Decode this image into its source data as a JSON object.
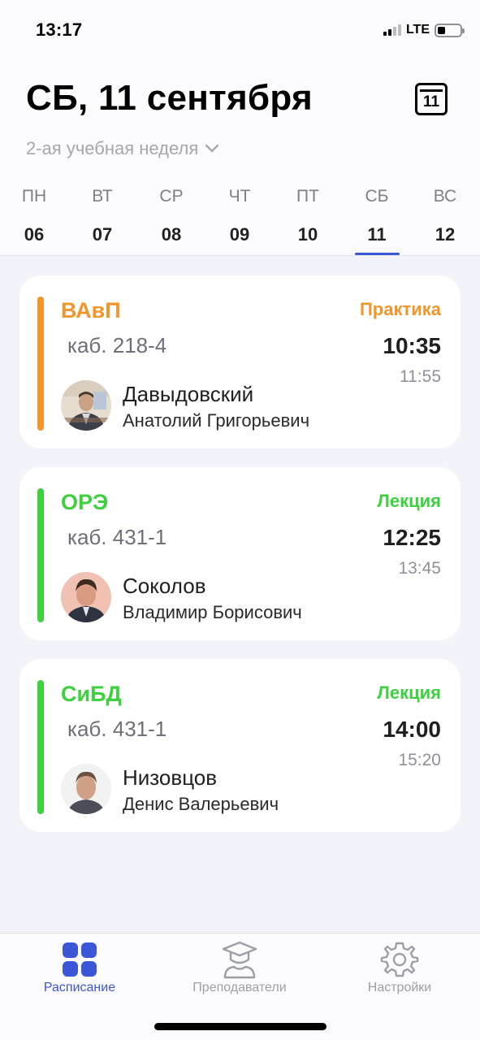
{
  "status_bar": {
    "time": "13:17",
    "network": "LTE",
    "signal_bars_filled": 2,
    "signal_bars_total": 4,
    "battery_level": 0.3
  },
  "header": {
    "date_title": "СБ, 11 сентября",
    "calendar_icon_day": "11",
    "week_label": "2-ая учебная неделя"
  },
  "days": [
    {
      "name": "ПН",
      "num": "06"
    },
    {
      "name": "ВТ",
      "num": "07"
    },
    {
      "name": "СР",
      "num": "08"
    },
    {
      "name": "ЧТ",
      "num": "09"
    },
    {
      "name": "ПТ",
      "num": "10"
    },
    {
      "name": "СБ",
      "num": "11",
      "selected": true
    },
    {
      "name": "ВС",
      "num": "12"
    }
  ],
  "lessons": [
    {
      "subject": "ВАвП",
      "room": "каб. 218-4",
      "type": "Практика",
      "start": "10:35",
      "end": "11:55",
      "teacher_surname": "Давыдовский",
      "teacher_name": "Анатолий Григорьевич",
      "color": "#f0962a"
    },
    {
      "subject": "ОРЭ",
      "room": "каб. 431-1",
      "type": "Лекция",
      "start": "12:25",
      "end": "13:45",
      "teacher_surname": "Соколов",
      "teacher_name": "Владимир Борисович",
      "color": "#3dd13d"
    },
    {
      "subject": "СиБД",
      "room": "каб. 431-1",
      "type": "Лекция",
      "start": "14:00",
      "end": "15:20",
      "teacher_surname": "Низовцов",
      "teacher_name": "Денис Валерьевич",
      "color": "#3dd13d"
    }
  ],
  "tabbar": {
    "schedule": "Расписание",
    "teachers": "Преподаватели",
    "settings": "Настройки",
    "active_color": "#3c56d8",
    "inactive_color": "#9c9fa7"
  }
}
